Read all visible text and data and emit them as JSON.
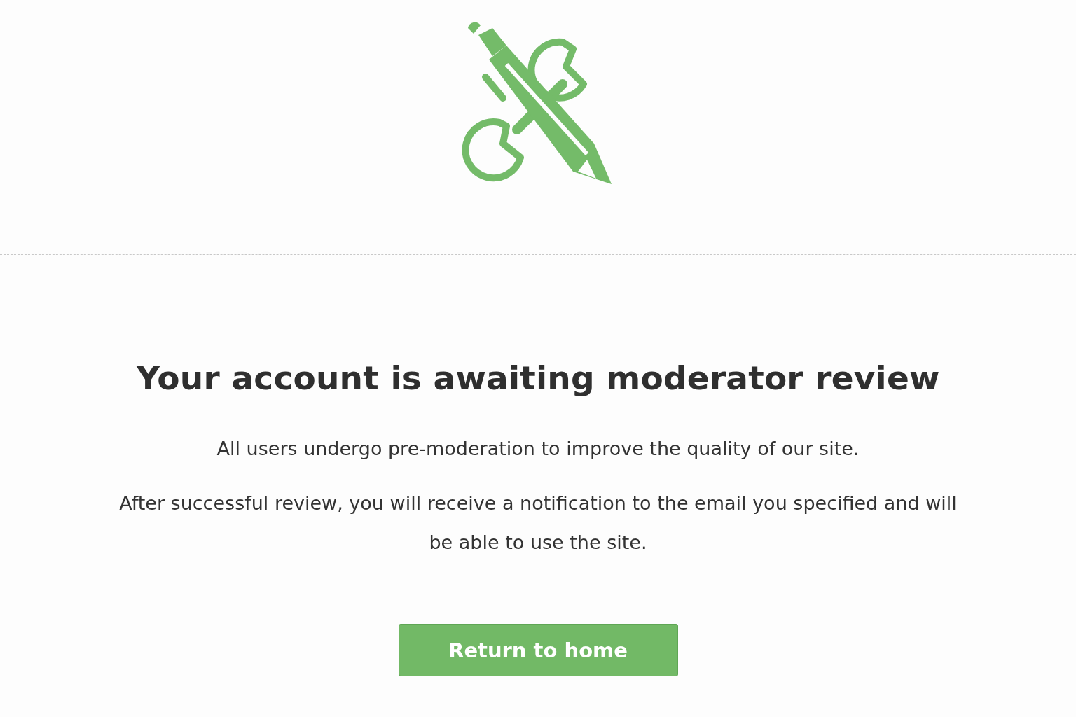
{
  "heading": "Your account is awaiting moderator review",
  "paragraphs": [
    "All users undergo pre-moderation to improve the quality of our site.",
    "After successful review, you will receive a notification to the email you specified and will be able to use the site."
  ],
  "button": {
    "label": "Return to home"
  }
}
